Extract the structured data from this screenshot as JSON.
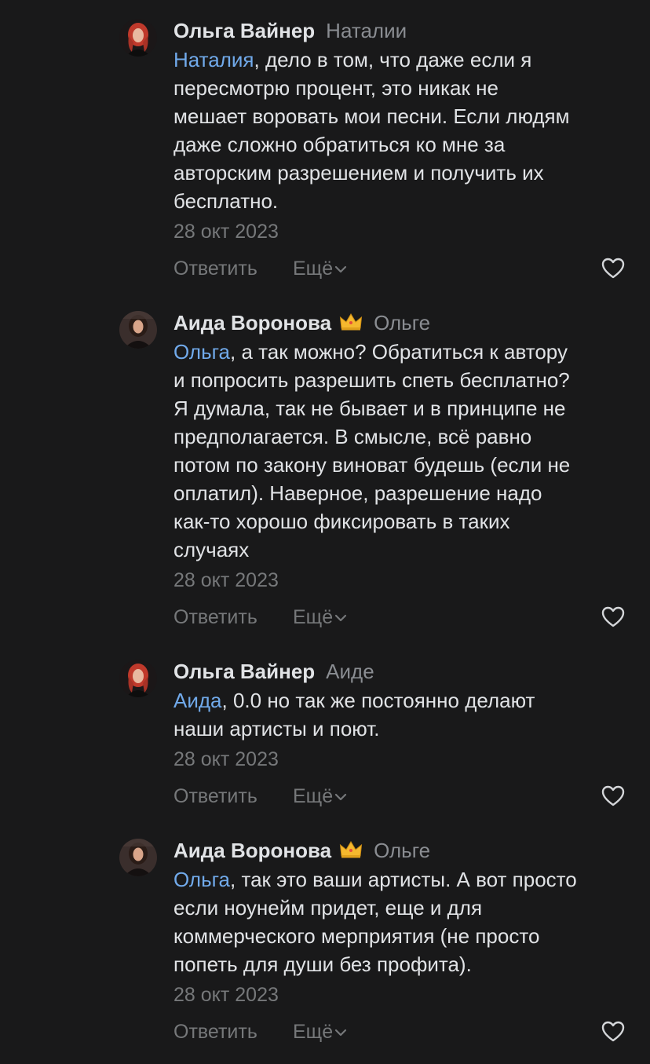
{
  "comments": [
    {
      "author": "Ольга Вайнер",
      "reply_to": "Наталии",
      "mention": "Наталия",
      "text": ", дело в том, что даже если я\nпересмотрю процент, это никак не\nмешает воровать мои песни. Если людям\nдаже сложно обратиться ко мне за\nавторским разрешением и получить их\nбесплатно.",
      "date": "28 окт 2023",
      "reply_label": "Ответить",
      "more_label": "Ещё",
      "avatar_icon": "avatar-red-hair-woman",
      "has_crown": false
    },
    {
      "author": "Аида Воронова",
      "reply_to": "Ольге",
      "mention": "Ольга",
      "text": ", а так можно? Обратиться к автору\nи попросить разрешить спеть бесплатно?\nЯ думала, так не бывает и в принципе не\nпредполагается. В смысле, всё равно\nпотом по закону виноват будешь (если не\nоплатил). Наверное, разрешение надо\nкак-то хорошо фиксировать в таких\nслучаях",
      "date": "28 окт 2023",
      "reply_label": "Ответить",
      "more_label": "Ещё",
      "avatar_icon": "avatar-dark-hair-woman",
      "has_crown": true
    },
    {
      "author": "Ольга Вайнер",
      "reply_to": "Аиде",
      "mention": "Аида",
      "text": ", 0.0 но так же постоянно делают\nнаши артисты и поют.",
      "date": "28 окт 2023",
      "reply_label": "Ответить",
      "more_label": "Ещё",
      "avatar_icon": "avatar-red-hair-woman",
      "has_crown": false
    },
    {
      "author": "Аида Воронова",
      "reply_to": "Ольге",
      "mention": "Ольга",
      "text": ", так это ваши артисты. А вот просто\nесли ноунейм придет, еще и для\nкоммерческого мерприятия (не просто\nпопеть для души без профита).",
      "date": "28 окт 2023",
      "reply_label": "Ответить",
      "more_label": "Ещё",
      "avatar_icon": "avatar-dark-hair-woman",
      "has_crown": true
    }
  ],
  "icons": {
    "like": "heart-outline-icon",
    "crown": "crown-icon",
    "more": "chevron-down-icon"
  },
  "colors": {
    "background": "#19191a",
    "text": "#e1e3e6",
    "secondary": "#76787a",
    "mention": "#71aaeb",
    "crown": "#f5b82e"
  }
}
